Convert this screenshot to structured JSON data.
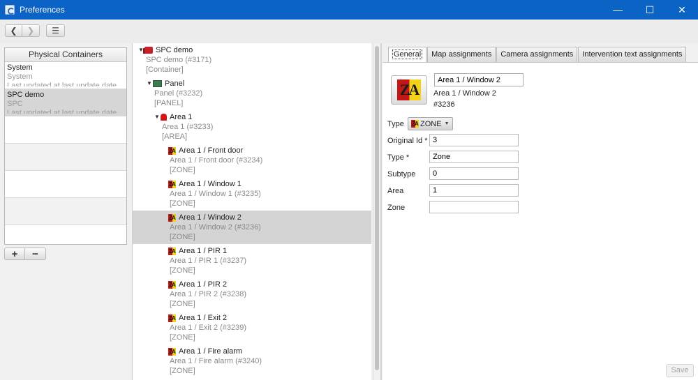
{
  "window": {
    "title": "Preferences",
    "controls": {
      "minimize": "—",
      "maximize": "☐",
      "close": "✕"
    }
  },
  "toolbar": {
    "back": "❮",
    "forward": "❯",
    "menu": "☰"
  },
  "containers": {
    "header": "Physical Containers",
    "items": [
      {
        "name": "System",
        "type": "System",
        "note": "Last updated at last update date"
      },
      {
        "name": "SPC demo",
        "type": "SPC",
        "note": "Last updated at last update date"
      }
    ],
    "add": "+",
    "remove": "−"
  },
  "tree": [
    {
      "title": "SPC demo",
      "id": "SPC demo (#3171)",
      "kind": "[Container]"
    },
    {
      "title": "Panel",
      "id": "Panel (#3232)",
      "kind": "[PANEL]"
    },
    {
      "title": "Area 1",
      "id": "Area 1 (#3233)",
      "kind": "[AREA]"
    },
    {
      "title": "Area 1 / Front door",
      "id": "Area 1 / Front door (#3234)",
      "kind": "[ZONE]"
    },
    {
      "title": "Area 1 / Window 1",
      "id": "Area 1 / Window 1 (#3235)",
      "kind": "[ZONE]"
    },
    {
      "title": "Area 1 / Window 2",
      "id": "Area 1 / Window 2 (#3236)",
      "kind": "[ZONE]"
    },
    {
      "title": "Area 1 / PIR 1",
      "id": "Area 1 / PIR 1 (#3237)",
      "kind": "[ZONE]"
    },
    {
      "title": "Area 1 / PIR 2",
      "id": "Area 1 / PIR 2 (#3238)",
      "kind": "[ZONE]"
    },
    {
      "title": "Area 1 / Exit 2",
      "id": "Area 1 / Exit 2 (#3239)",
      "kind": "[ZONE]"
    },
    {
      "title": "Area 1 / Fire alarm",
      "id": "Area 1 / Fire alarm (#3240)",
      "kind": "[ZONE]"
    }
  ],
  "zone_icon_text": "ZA",
  "tabs": [
    "General",
    "Map assignments",
    "Camera assignments",
    "Intervention text assignments"
  ],
  "detail": {
    "icon_text": "ZA",
    "name": "Area 1 / Window 2",
    "display_name": "Area 1 / Window 2",
    "id": "#3236",
    "type_label": "Type",
    "type_value": "ZONE",
    "fields": [
      {
        "label": "Original Id *",
        "value": "3"
      },
      {
        "label": "Type *",
        "value": "Zone"
      },
      {
        "label": "Subtype",
        "value": "0"
      },
      {
        "label": "Area",
        "value": "1"
      },
      {
        "label": "Zone",
        "value": ""
      }
    ],
    "save": "Save"
  }
}
